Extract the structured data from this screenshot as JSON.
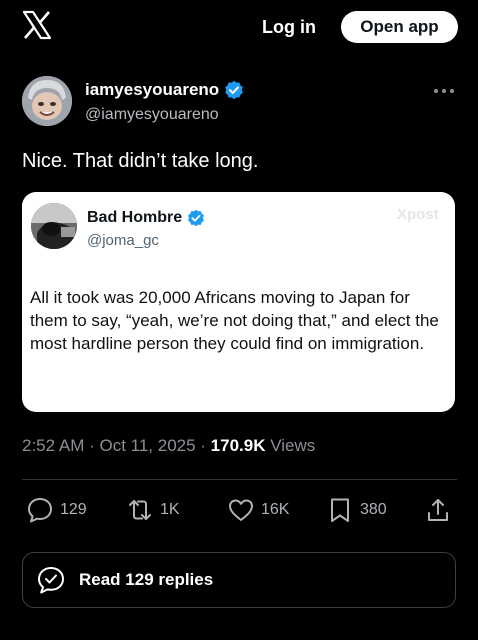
{
  "header": {
    "login_label": "Log in",
    "open_app_label": "Open app"
  },
  "post": {
    "author_name": "iamyesyouareno",
    "author_handle": "@iamyesyouareno",
    "text": "Nice. That didn’t take long.",
    "timestamp": "2:52 AM · Oct 11, 2025 · ",
    "views_count": "170.9K",
    "views_label": " Views"
  },
  "quote": {
    "author_name": "Bad Hombre",
    "author_handle": "@joma_gc",
    "watermark": "Xpost",
    "text": "All it took was 20,000 Africans moving to Japan for them to say, “yeah, we’re not doing that,” and elect the most hardline person they could find on immigration."
  },
  "actions": {
    "replies": "129",
    "reposts": "1K",
    "likes": "16K",
    "bookmarks": "380"
  },
  "read_replies_label": "Read 129 replies",
  "colors": {
    "background": "#000000",
    "verified": "#1d9bf0",
    "muted_text": "#8b9096"
  }
}
